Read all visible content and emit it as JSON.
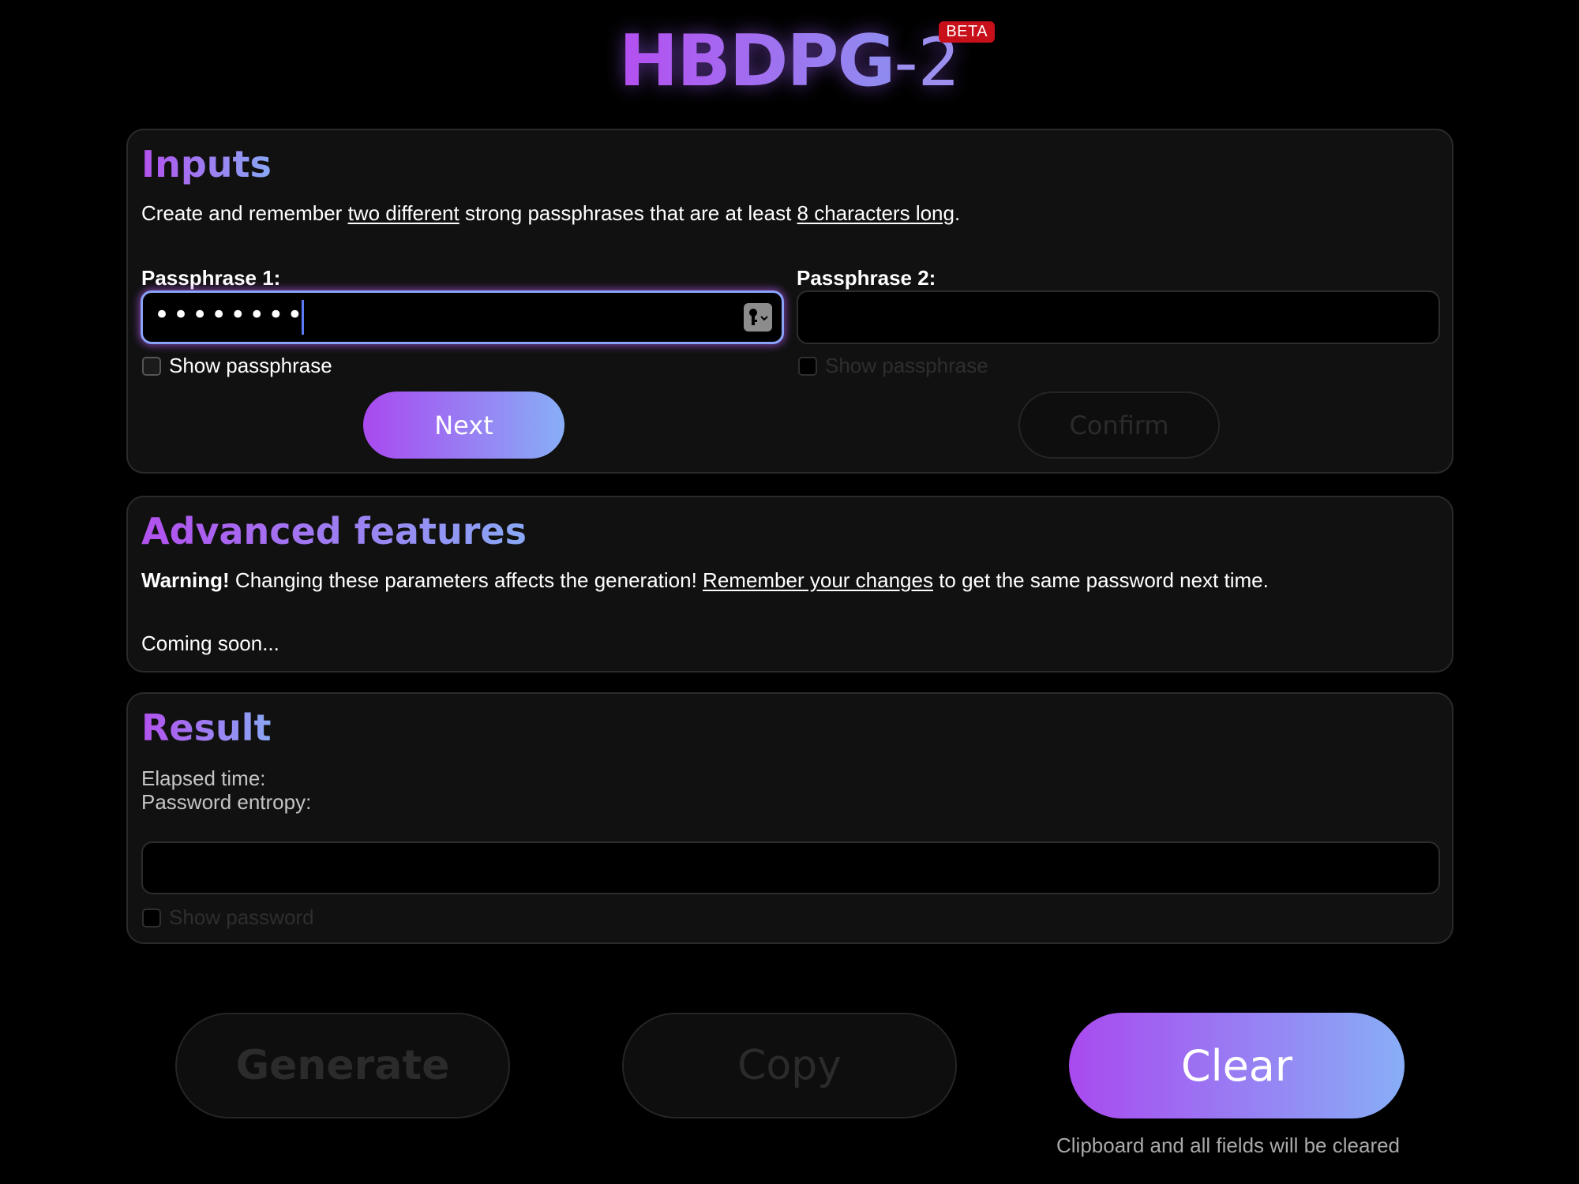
{
  "header": {
    "logo_main": "HBDPG",
    "logo_suffix": "-2",
    "badge": "BETA"
  },
  "inputs": {
    "title": "Inputs",
    "instructions": {
      "part1": "Create and remember ",
      "emph1": "two different",
      "part2": " strong passphrases that are at least ",
      "emph2": "8 characters long",
      "part3": "."
    },
    "passphrase1": {
      "label": "Passphrase 1:",
      "masked_value": "••••••••",
      "show_label": "Show passphrase",
      "button": "Next"
    },
    "passphrase2": {
      "label": "Passphrase 2:",
      "value": "",
      "show_label": "Show passphrase",
      "button": "Confirm"
    }
  },
  "advanced": {
    "title": "Advanced features",
    "warning_strong": "Warning!",
    "warning_text1": " Changing these parameters affects the generation! ",
    "warning_link": "Remember your changes",
    "warning_text2": " to get the same password next time.",
    "coming_soon": "Coming soon..."
  },
  "result": {
    "title": "Result",
    "elapsed_label": "Elapsed time:",
    "entropy_label": "Password entropy:",
    "password_value": "",
    "show_label": "Show password"
  },
  "actions": {
    "generate": "Generate",
    "copy": "Copy",
    "clear": "Clear",
    "clear_hint": "Clipboard and all fields will be cleared"
  },
  "colors": {
    "accent_start": "#a94af0",
    "accent_end": "#88aef6",
    "beta_badge": "#c8101b",
    "focus_border": "#8aa2f8"
  },
  "icons": {
    "passphrase1_field_icon": "key-icon"
  }
}
